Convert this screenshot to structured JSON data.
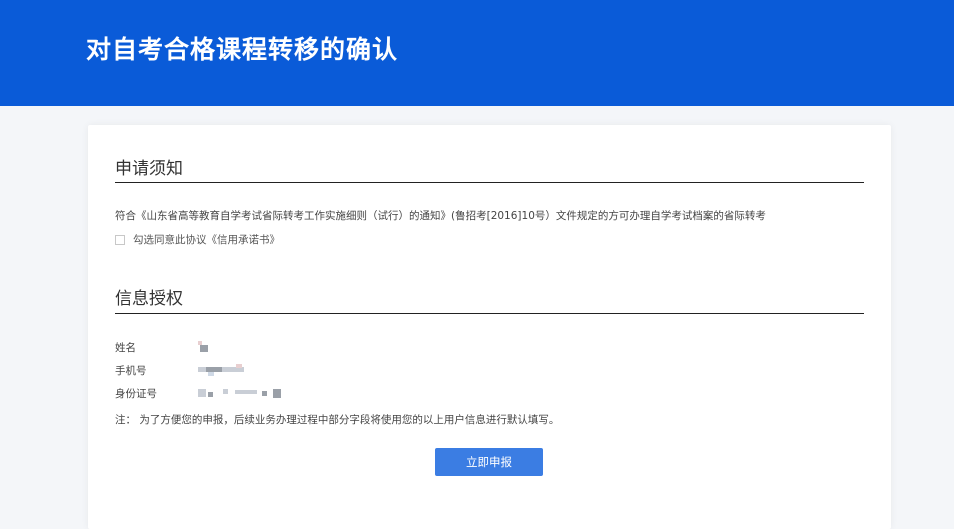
{
  "header": {
    "title": "对自考合格课程转移的确认"
  },
  "notice": {
    "title": "申请须知",
    "text": "符合《山东省高等教育自学考试省际转考工作实施细则（试行）的通知》(鲁招考[2016]10号）文件规定的方可办理自学考试档案的省际转考",
    "agree_label": "勾选同意此协议《信用承诺书》",
    "agree_checked": false
  },
  "authorization": {
    "title": "信息授权",
    "fields": [
      {
        "label": "姓名"
      },
      {
        "label": "手机号"
      },
      {
        "label": "身份证号"
      }
    ],
    "note": "注：  为了方便您的申报，后续业务办理过程中部分字段将使用您的以上用户信息进行默认填写。"
  },
  "submit_label": "立即申报",
  "colors": {
    "banner": "#0a5bd8",
    "button": "#3b7de3"
  }
}
